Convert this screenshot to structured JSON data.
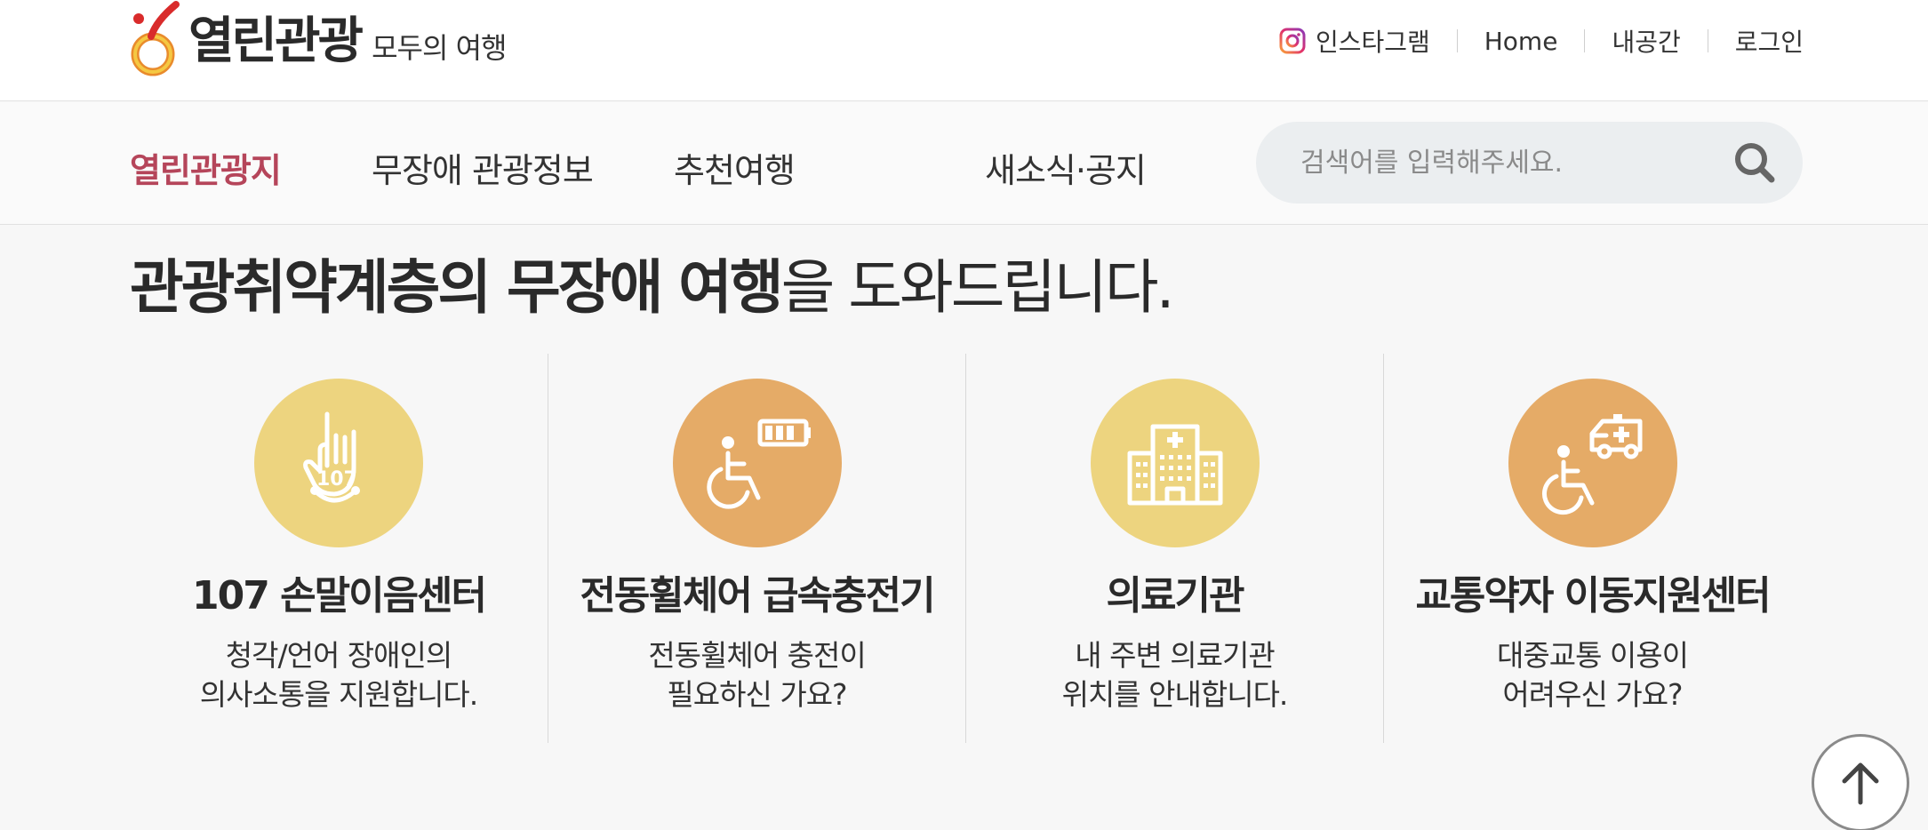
{
  "header": {
    "logo_text": "열린관광",
    "logo_sub": "모두의 여행",
    "util_links": [
      {
        "label": "인스타그램"
      },
      {
        "label": "Home"
      },
      {
        "label": "내공간"
      },
      {
        "label": "로그인"
      }
    ]
  },
  "nav": {
    "items": [
      {
        "label": "열린관광지",
        "active": true
      },
      {
        "label": "무장애 관광정보"
      },
      {
        "label": "추천여행"
      },
      {
        "label": "새소식·공지"
      }
    ],
    "search_placeholder": "검색어를 입력해주세요."
  },
  "main": {
    "headline_bold": "관광취약계층의 무장애 여행",
    "headline_light": "을 도와드립니다.",
    "cards": [
      {
        "title": "107 손말이음센터",
        "desc1": "청각/언어 장애인의",
        "desc2": "의사소통을 지원합니다.",
        "icon": "sign-language-phone-icon",
        "color": "#edd47f"
      },
      {
        "title": "전동휠체어 급속충전기",
        "desc1": "전동휠체어 충전이",
        "desc2": "필요하신 가요?",
        "icon": "wheelchair-battery-icon",
        "color": "#e5ab67"
      },
      {
        "title": "의료기관",
        "desc1": "내 주변 의료기관",
        "desc2": "위치를 안내합니다.",
        "icon": "hospital-icon",
        "color": "#edd47f"
      },
      {
        "title": "교통약자 이동지원센터",
        "desc1": "대중교통 이용이",
        "desc2": "어려우신 가요?",
        "icon": "wheelchair-ambulance-icon",
        "color": "#e5ab67"
      }
    ]
  },
  "colors": {
    "accent": "#b5455a",
    "yellow": "#edd47f",
    "orange": "#e5ab67"
  },
  "icons": {
    "top_button": "arrow-up-icon",
    "search": "search-icon",
    "instagram": "instagram-icon"
  }
}
